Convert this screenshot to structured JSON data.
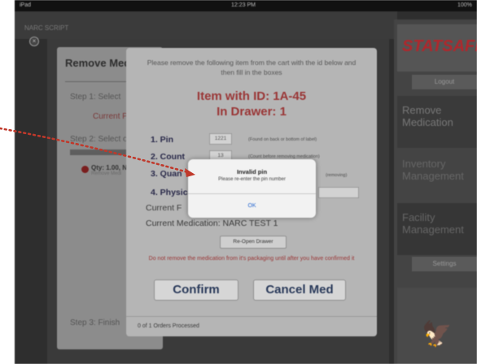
{
  "status_bar": {
    "carrier": "iPad",
    "time": "12:23 PM",
    "battery": "100%"
  },
  "app_header": {
    "title": "NARC SCRIPT",
    "close_glyph": "×"
  },
  "sidebar": {
    "logo": "STATSAFE",
    "logout": "Logout",
    "items": [
      {
        "label": "Remove\nMedication"
      },
      {
        "label": "Inventory\nManagement"
      },
      {
        "label": "Facility\nManagement"
      }
    ],
    "settings": "Settings",
    "bird_glyph": "🦅"
  },
  "background_card": {
    "title": "Remove Med",
    "step1": "Step 1: Select",
    "current_red": "Current P",
    "step2": "Step 2: Select o",
    "qty": "Qty: 1.00, NA",
    "qty_sub": "Remove Medi",
    "step3": "Step 3: Finish"
  },
  "modal": {
    "instruction": "Please remove the following item from the cart with the id below and then fill in the boxes",
    "id_line1": "Item with ID: 1A-45",
    "id_line2": "In Drawer: 1",
    "fields": [
      {
        "label": "1. Pin",
        "value": "1221",
        "hint": "(Found on back or bottom of label)"
      },
      {
        "label": "2. Count",
        "value": "13",
        "hint": "(Count before removing medication)"
      },
      {
        "label": "3. Quan",
        "value": "",
        "hint": "(removing)"
      },
      {
        "label": "4. Physic",
        "value": "",
        "hint": ""
      }
    ],
    "current_patient_label": "Current F",
    "current_medication": "Current Medication: NARC TEST 1",
    "reopen_button": "Re-Open Drawer",
    "warning": "Do not remove the medication from it's packaging until after you have confirmed it",
    "confirm_button": "Confirm",
    "cancel_button": "Cancel Med",
    "footer": "0 of 1 Orders Processed"
  },
  "alert": {
    "title": "Invalid pin",
    "message": "Please re-enter the pin number",
    "ok_button": "OK"
  },
  "colors": {
    "annotation_red": "#c0392b",
    "accent_red": "#9a3636",
    "ios_blue": "#2a6ad0"
  }
}
